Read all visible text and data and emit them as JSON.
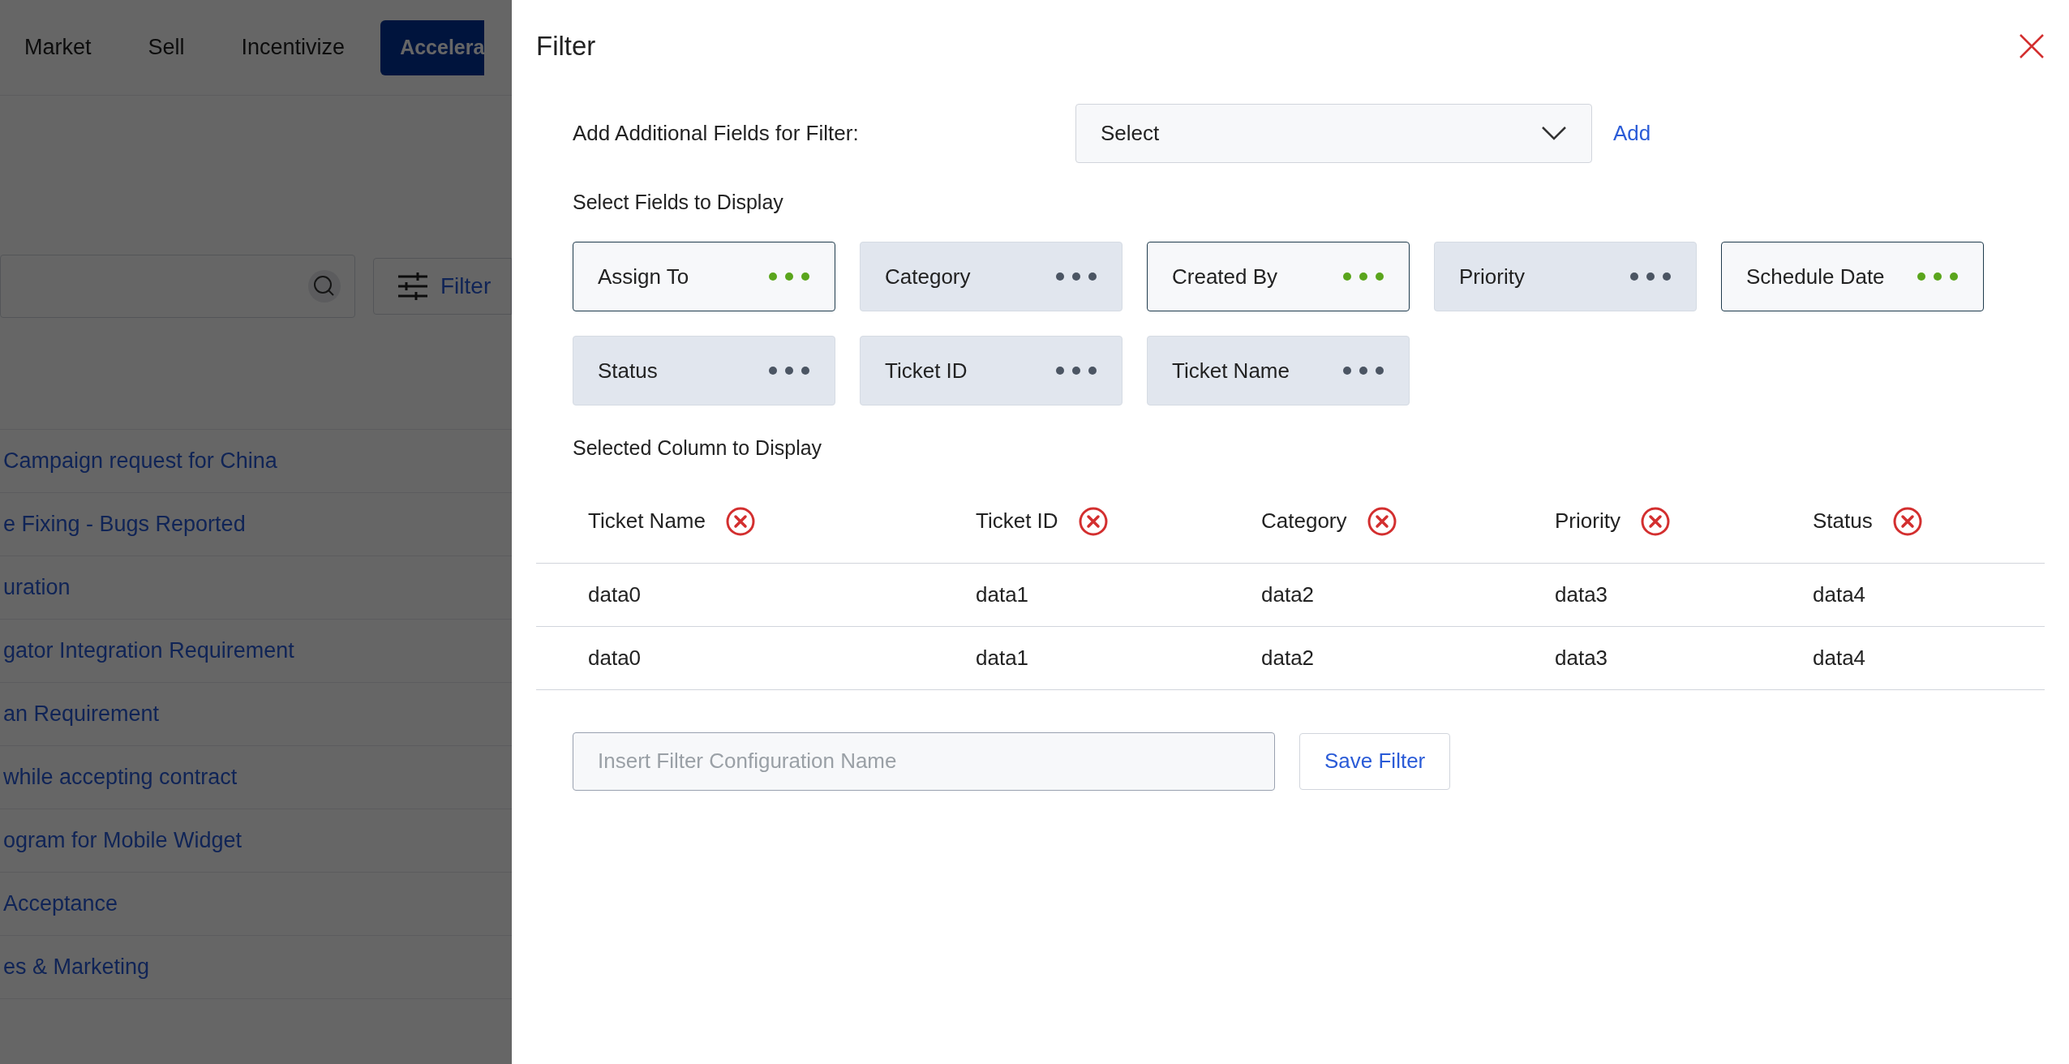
{
  "background": {
    "nav": [
      {
        "label": "Market",
        "selected": false
      },
      {
        "label": "Sell",
        "selected": false
      },
      {
        "label": "Incentivize",
        "selected": false
      },
      {
        "label": "Accelera",
        "selected": true
      }
    ],
    "filter_button": "Filter",
    "list": [
      "Campaign request for China",
      "e Fixing - Bugs Reported",
      "uration",
      "gator Integration Requirement",
      "an Requirement",
      "while accepting contract",
      "ogram for Mobile Widget",
      "Acceptance",
      "es & Marketing"
    ]
  },
  "dialog": {
    "title": "Filter",
    "add_field": {
      "label": "Add Additional Fields for Filter:",
      "value": "Select",
      "button": "Add"
    },
    "fields_heading": "Select Fields to Display",
    "fields": [
      {
        "label": "Assign To",
        "selected": true
      },
      {
        "label": "Category",
        "selected": false
      },
      {
        "label": "Created By",
        "selected": true
      },
      {
        "label": "Priority",
        "selected": false
      },
      {
        "label": "Schedule Date",
        "selected": true
      },
      {
        "label": "Status",
        "selected": false
      },
      {
        "label": "Ticket ID",
        "selected": false
      },
      {
        "label": "Ticket Name",
        "selected": false
      }
    ],
    "columns_heading": "Selected Column to Display",
    "table": {
      "columns": [
        "Ticket Name",
        "Ticket ID",
        "Category",
        "Priority",
        "Status"
      ],
      "rows": [
        [
          "data0",
          "data1",
          "data2",
          "data3",
          "data4"
        ],
        [
          "data0",
          "data1",
          "data2",
          "data3",
          "data4"
        ]
      ]
    },
    "config_name": {
      "placeholder": "Insert Filter Configuration Name"
    },
    "save_button": "Save Filter"
  }
}
